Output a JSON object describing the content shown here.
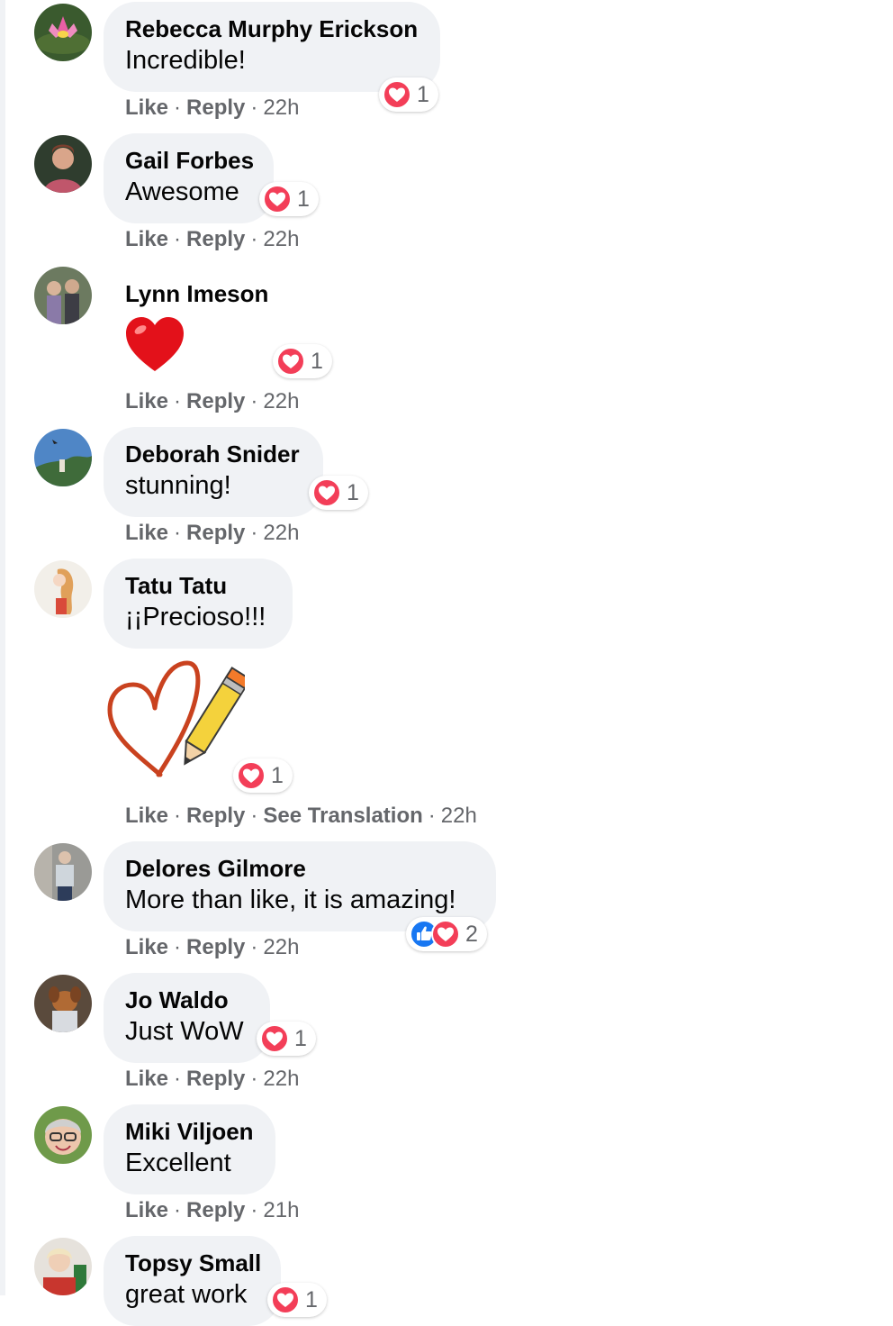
{
  "actions": {
    "like": "Like",
    "reply": "Reply",
    "see_translation": "See Translation",
    "sep": "·"
  },
  "colors": {
    "bubble": "#f0f2f5",
    "love": "#f33e58",
    "like": "#1877f2",
    "meta": "#65676b"
  },
  "comments": [
    {
      "name": "Rebecca Murphy Erickson",
      "text": "Incredible!",
      "time": "22h",
      "reactions": [
        "love"
      ],
      "count": "1",
      "avatar": "water-lily"
    },
    {
      "name": "Gail Forbes",
      "text": "Awesome",
      "time": "22h",
      "reactions": [
        "love"
      ],
      "count": "1",
      "avatar": "woman-portrait"
    },
    {
      "name": "Lynn Imeson",
      "text": "",
      "emoji": "red-heart",
      "time": "22h",
      "reactions": [
        "love"
      ],
      "count": "1",
      "avatar": "couple-photo"
    },
    {
      "name": "Deborah Snider",
      "text": "stunning!",
      "time": "22h",
      "reactions": [
        "love"
      ],
      "count": "1",
      "avatar": "landscape-sky"
    },
    {
      "name": "Tatu Tatu",
      "text": "¡¡Precioso!!!",
      "sticker": "heart-pencil",
      "time": "22h",
      "reactions": [
        "love"
      ],
      "count": "1",
      "avatar": "drawn-girl"
    },
    {
      "name": "Delores Gilmore",
      "text": "More than like, it is amazing!",
      "time": "22h",
      "reactions": [
        "like",
        "love"
      ],
      "count": "2",
      "avatar": "standing-woman"
    },
    {
      "name": "Jo Waldo",
      "text": "Just WoW",
      "time": "22h",
      "reactions": [
        "love"
      ],
      "count": "1",
      "avatar": "dog-photo"
    },
    {
      "name": "Miki Viljoen",
      "text": "Excellent",
      "time": "21h",
      "reactions": [],
      "count": "",
      "avatar": "smiling-woman"
    },
    {
      "name": "Topsy Small",
      "text": "great work",
      "time": "",
      "reactions": [
        "love"
      ],
      "count": "1",
      "avatar": "holiday-woman"
    }
  ]
}
